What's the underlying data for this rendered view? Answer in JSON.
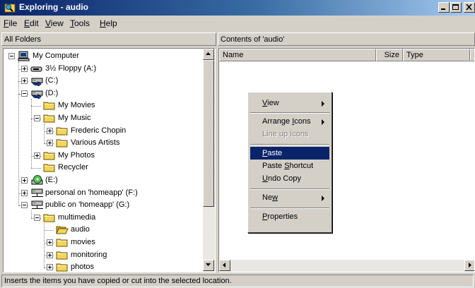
{
  "window": {
    "title": "Exploring - audio",
    "icon": "explorer-icon"
  },
  "menu": [
    {
      "label": "File",
      "accel": "F",
      "rest": "ile"
    },
    {
      "label": "Edit",
      "accel": "E",
      "rest": "dit"
    },
    {
      "label": "View",
      "accel": "V",
      "rest": "iew"
    },
    {
      "label": "Tools",
      "accel": "T",
      "rest": "ools"
    },
    {
      "label": "Help",
      "accel": "H",
      "rest": "elp"
    }
  ],
  "left_pane": {
    "header": "All Folders"
  },
  "right_pane": {
    "header": "Contents of 'audio'",
    "columns": [
      "Name",
      "Size",
      "Type",
      "M"
    ]
  },
  "tree": [
    {
      "label": "My Computer",
      "icon": "computer-icon",
      "toggle": "minus"
    },
    {
      "label": "3½ Floppy (A:)",
      "icon": "floppy-drive-icon",
      "toggle": "plus"
    },
    {
      "label": "(C:)",
      "icon": "shared-drive-icon",
      "toggle": "plus"
    },
    {
      "label": "(D:)",
      "icon": "shared-drive-icon",
      "toggle": "minus"
    },
    {
      "label": "My Movies",
      "icon": "folder-icon",
      "toggle": "none"
    },
    {
      "label": "My Music",
      "icon": "folder-icon",
      "toggle": "minus"
    },
    {
      "label": "Frederic Chopin",
      "icon": "folder-icon",
      "toggle": "plus"
    },
    {
      "label": "Various Artists",
      "icon": "folder-icon",
      "toggle": "plus"
    },
    {
      "label": "My Photos",
      "icon": "folder-icon",
      "toggle": "plus"
    },
    {
      "label": "Recycler",
      "icon": "folder-icon",
      "toggle": "none"
    },
    {
      "label": "(E:)",
      "icon": "cd-drive-icon",
      "toggle": "plus"
    },
    {
      "label": "personal on 'homeapp' (F:)",
      "icon": "network-drive-icon",
      "toggle": "plus"
    },
    {
      "label": "public on 'homeapp' (G:)",
      "icon": "network-drive-icon",
      "toggle": "minus"
    },
    {
      "label": "multimedia",
      "icon": "folder-icon",
      "toggle": "minus"
    },
    {
      "label": "audio",
      "icon": "open-folder-icon",
      "toggle": "none"
    },
    {
      "label": "movies",
      "icon": "folder-icon",
      "toggle": "plus"
    },
    {
      "label": "monitoring",
      "icon": "folder-icon",
      "toggle": "plus"
    },
    {
      "label": "photos",
      "icon": "folder-icon",
      "toggle": "plus"
    }
  ],
  "context_menu": [
    {
      "label": "View",
      "accel": "V",
      "pre": "",
      "rest": "iew",
      "submenu": true,
      "state": "normal"
    },
    {
      "separator": true
    },
    {
      "label": "Arrange Icons",
      "pre": "Arrange ",
      "accel": "I",
      "rest": "cons",
      "submenu": true,
      "state": "normal"
    },
    {
      "label": "Line up Icons",
      "pre": "Line up Icons",
      "accel": "",
      "rest": "",
      "submenu": false,
      "state": "disabled"
    },
    {
      "separator": true
    },
    {
      "label": "Paste",
      "pre": "",
      "accel": "P",
      "rest": "aste",
      "submenu": false,
      "state": "selected"
    },
    {
      "label": "Paste Shortcut",
      "pre": "Paste ",
      "accel": "S",
      "rest": "hortcut",
      "submenu": false,
      "state": "normal"
    },
    {
      "label": "Undo Copy",
      "pre": "",
      "accel": "U",
      "rest": "ndo Copy",
      "submenu": false,
      "state": "normal"
    },
    {
      "separator": true
    },
    {
      "label": "New",
      "pre": "Ne",
      "accel": "w",
      "rest": "",
      "submenu": true,
      "state": "normal"
    },
    {
      "separator": true
    },
    {
      "label": "Properties",
      "pre": "",
      "accel": "P",
      "rest": "roperties",
      "submenu": false,
      "state": "normal"
    }
  ],
  "status_bar": "Inserts the items you have copied or cut into the selected location.",
  "colors": {
    "face": "#d4d0c8",
    "title_start": "#0a246a",
    "title_end": "#a6caf0",
    "selection": "#0a246a",
    "folder": "#f2d65a"
  }
}
